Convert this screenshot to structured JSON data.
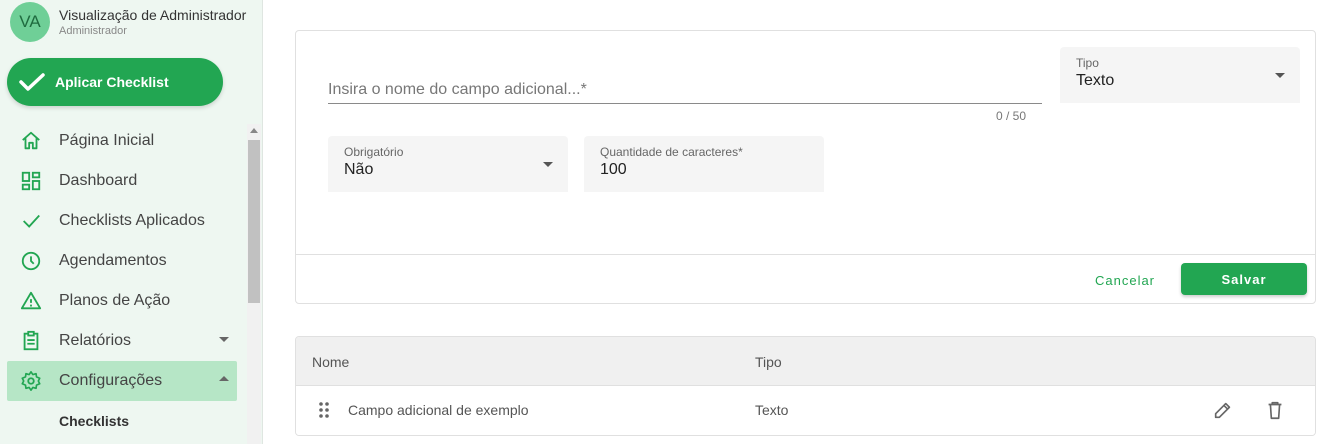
{
  "user": {
    "initials": "VA",
    "name": "Visualização de Administrador",
    "role": "Administrador"
  },
  "apply_button": "Aplicar Checklist",
  "nav": {
    "items": [
      {
        "label": "Página Inicial",
        "icon": "home-icon"
      },
      {
        "label": "Dashboard",
        "icon": "dashboard-icon"
      },
      {
        "label": "Checklists Aplicados",
        "icon": "check-icon"
      },
      {
        "label": "Agendamentos",
        "icon": "clock-icon"
      },
      {
        "label": "Planos de Ação",
        "icon": "warning-icon"
      },
      {
        "label": "Relatórios",
        "icon": "clipboard-icon"
      },
      {
        "label": "Configurações",
        "icon": "gear-icon"
      }
    ],
    "subitems": [
      {
        "label": "Checklists"
      }
    ]
  },
  "form": {
    "name_placeholder": "Insira o nome do campo adicional...*",
    "name_value": "",
    "counter": "0 / 50",
    "tipo_label": "Tipo",
    "tipo_value": "Texto",
    "obrigatorio_label": "Obrigatório",
    "obrigatorio_value": "Não",
    "quantidade_label": "Quantidade de caracteres*",
    "quantidade_value": "100",
    "cancel_label": "Cancelar",
    "save_label": "Salvar"
  },
  "table": {
    "headers": [
      "Nome",
      "Tipo"
    ],
    "rows": [
      {
        "nome": "Campo adicional de exemplo",
        "tipo": "Texto"
      }
    ]
  },
  "colors": {
    "accent": "#22a652",
    "sidebar_bg": "#eef7f1",
    "active_bg": "#b6e6c6"
  }
}
